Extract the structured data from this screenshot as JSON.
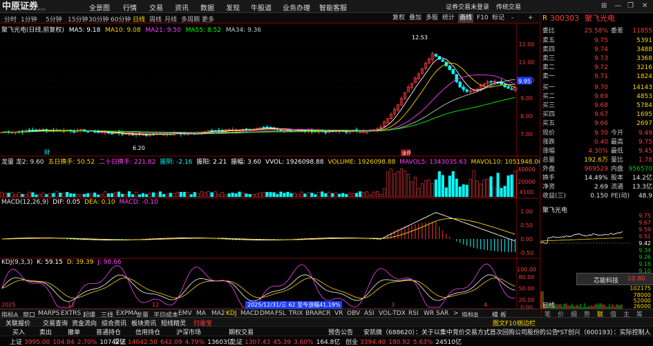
{
  "app": {
    "logo_text": "中原证券",
    "logo_sub": "CENTRAL CHINA SECURITIES",
    "menu": [
      "全景图",
      "行情",
      "交易",
      "资讯",
      "数据",
      "发现",
      "牛股道",
      "业务办理",
      "智能客服"
    ],
    "login": "证券交易未登录",
    "trade_link": "传统交易",
    "window_controls": [
      "⊞",
      "—",
      "❐",
      "✕"
    ]
  },
  "period_bar": {
    "periods": [
      "分时",
      "1分钟",
      "5分钟",
      "15分钟",
      "30分钟",
      "60分钟",
      "日线",
      "周线",
      "月线",
      "多周期",
      "更多"
    ],
    "active_index": 6,
    "tools": [
      "复权",
      "叠加",
      "多股",
      "统计",
      "画线",
      "F10",
      "标记",
      "-",
      "+"
    ],
    "tool_highlight_index": 4
  },
  "main_chart": {
    "title_name": "聚飞光电(日线,前复权)",
    "ma": [
      {
        "label": "MA5: 9.18",
        "color": "#ffffff"
      },
      {
        "label": "MA10: 9.08",
        "color": "#ffd700"
      },
      {
        "label": "MA21: 9.50",
        "color": "#ff40ff"
      },
      {
        "label": "MA55: 8.52",
        "color": "#00ff00"
      },
      {
        "label": "MA34: 9.36",
        "color": "#c8c8c8"
      }
    ],
    "y_ticks": [
      "12.00",
      "11.00",
      "10.00",
      "9.00",
      "8.00",
      "7.00"
    ],
    "y_tick_values": [
      12,
      11,
      10,
      9,
      8,
      7
    ],
    "high_label": "12.53",
    "low_label": "6.20",
    "current_price_label": "9.95",
    "marker_left": "财",
    "marker_right": "涨停",
    "date_label": "2025/12/31/三 62 至今涨幅41.19%"
  },
  "volume_panel": {
    "title": "龙量 龙2: 9.60",
    "items": [
      {
        "label": "五日换手: 50.52",
        "color": "#ffd700"
      },
      {
        "label": "二十日换手: 221.82",
        "color": "#ff40ff"
      },
      {
        "label": "振阴: -2.16",
        "color": "#00ffff"
      },
      {
        "label": "振阳: 2.21",
        "color": "#ffffff"
      },
      {
        "label": "振幅: 3.60",
        "color": "#ffffff"
      },
      {
        "label": "VVOL: 1926098.88",
        "color": "#ffffff"
      },
      {
        "label": "VOLUME: 1926098.88",
        "color": "#ffd700"
      },
      {
        "label": "MAVOL5: 1343035.63",
        "color": "#ff40ff"
      },
      {
        "label": "MAVOL10: 1051948.00",
        "color": "#ffd700"
      }
    ],
    "y_ticks": [
      "40000",
      "20000",
      "X100"
    ]
  },
  "macd_panel": {
    "title": "MACD(12,26,9)",
    "items": [
      {
        "label": "DIF: 0.05",
        "color": "#ffffff"
      },
      {
        "label": "DEA: 0.10",
        "color": "#ffd700"
      },
      {
        "label": "MACD: -0.10",
        "color": "#ff40ff"
      }
    ],
    "y_ticks": [
      "1.00",
      "0.50",
      "0.00",
      "-0.50"
    ]
  },
  "kdj_panel": {
    "title": "KDJ(9,3,3)",
    "items": [
      {
        "label": "K: 59.15",
        "color": "#ffffff"
      },
      {
        "label": "D: 39.39",
        "color": "#ffd700"
      },
      {
        "label": "J: 98.66",
        "color": "#ff40ff"
      }
    ],
    "y_ticks": [
      "100.00",
      "80.00",
      "50.00",
      "20.00",
      "0.00"
    ],
    "x_labels": [
      "2025",
      "11",
      "12",
      "1",
      "3",
      "4"
    ]
  },
  "indicator_bar": {
    "tabs": [
      "指标A",
      "窗口",
      "MARPS",
      "EXTRS",
      "起爆",
      "三线",
      "EXPMA",
      "龙量",
      "平均成本",
      "EMV",
      "MA",
      "MA2",
      "KDJ",
      "MACD",
      "DMA",
      "FSL",
      "TRIX",
      "BRAR",
      "CR",
      "VR",
      "OBV",
      "ASI",
      "VOL-TDX",
      "RSI",
      "WR",
      "SAR",
      ">",
      "指标B",
      "模",
      "板"
    ],
    "active": "KDJ"
  },
  "side_panel": {
    "code": "300303",
    "name": "聚飞光电",
    "weibi": {
      "label": "委比",
      "value": "25.58%",
      "label2": "委差",
      "value2": "11855"
    },
    "asks": [
      {
        "label": "卖五",
        "price": "9.75",
        "vol": "5391"
      },
      {
        "label": "卖四",
        "price": "9.74",
        "vol": "3488"
      },
      {
        "label": "卖三",
        "price": "9.73",
        "vol": "3368"
      },
      {
        "label": "卖二",
        "price": "9.72",
        "vol": "3216"
      },
      {
        "label": "卖一",
        "price": "9.71",
        "vol": "1824"
      }
    ],
    "bids": [
      {
        "label": "买一",
        "price": "9.70",
        "vol": "14143"
      },
      {
        "label": "买二",
        "price": "9.69",
        "vol": "4853"
      },
      {
        "label": "买三",
        "price": "9.68",
        "vol": "5784"
      },
      {
        "label": "买四",
        "price": "9.67",
        "vol": "1695"
      },
      {
        "label": "买五",
        "price": "9.66",
        "vol": "2697"
      }
    ],
    "stats": [
      {
        "l1": "现价",
        "v1": "9.70",
        "c1": "red",
        "l2": "今开",
        "v2": "9.49",
        "c2": "red"
      },
      {
        "l1": "涨跌",
        "v1": "0.40",
        "c1": "red",
        "l2": "最高",
        "v2": "9.75",
        "c2": "red"
      },
      {
        "l1": "涨幅",
        "v1": "4.30%",
        "c1": "red",
        "l2": "最低",
        "v2": "9.45",
        "c2": "red"
      },
      {
        "l1": "总量",
        "v1": "192.6万",
        "c1": "yellow",
        "l2": "量比",
        "v2": "1.78",
        "c2": "red"
      },
      {
        "l1": "外盘",
        "v1": "969529",
        "c1": "red",
        "l2": "内盘",
        "v2": "956570",
        "c2": "green"
      },
      {
        "l1": "换手",
        "v1": "14.49%",
        "c1": "white",
        "l2": "股本",
        "v2": "14.2亿",
        "c2": "white"
      },
      {
        "l1": "净资",
        "v1": "2.69",
        "c1": "white",
        "l2": "流通",
        "v2": "13.3亿",
        "c2": "white"
      },
      {
        "l1": "收益(三)",
        "v1": "0.150",
        "c1": "white",
        "l2": "PE(动)",
        "v2": "48.9",
        "c2": "white"
      }
    ],
    "mini_title": "聚飞光电",
    "mini_y": [
      "9.75",
      "9.67",
      "9.59",
      "9.51",
      "9.42",
      "9.34",
      "9.26",
      "9.18",
      "9.10"
    ],
    "mini_vol": "102175",
    "mini_vol2": "78000",
    "mini_vol3": "52000",
    "mini_vol4": "26000",
    "popup": {
      "name": "芯能科技",
      "price": "10.80"
    },
    "tab": "日线",
    "bottom_tabs": [
      "笔",
      "价",
      "细",
      "势",
      "联",
      "值",
      "主",
      "筹"
    ],
    "bottom_tab_active": 4
  },
  "bottom_bar1": {
    "items": [
      "关联报价",
      "交易查询",
      "资金流向",
      "综合资讯",
      "板块资讯",
      "短线精灵",
      "扫雷宝"
    ],
    "right": [
      "图文F10",
      "侧边栏"
    ]
  },
  "bottom_bar2": {
    "items": [
      "买入",
      "卖出",
      "撤单",
      "普通持仓",
      "信用持仓",
      "沪深市场",
      "期权交易"
    ],
    "news1": "预告公告",
    "news2": "安凯微（688620）：关于以集中竞价交易方式首次回购公司股份的公告",
    "news3": "*ST创兴（600193）：实际控制人ラ"
  },
  "bottom_bar3": [
    {
      "label": "上证",
      "v": "3995.00",
      "c": "104.84",
      "p": "2.70%",
      "amt": "10742亿"
    },
    {
      "label": "深证",
      "v": "14042.50",
      "c": "642.09",
      "p": "4.79%",
      "amt": "13603亿"
    },
    {
      "label": "北证",
      "v": "1307.43",
      "c": "45.39",
      "p": "3.60%",
      "amt": "164.8亿"
    },
    {
      "label": "创业",
      "v": "3394.40",
      "c": "180.92",
      "p": "5.63%",
      "amt": "24510亿"
    }
  ],
  "colors": {
    "up": "#ff3c3c",
    "down": "#00ffff",
    "accent": "#ffd700",
    "border": "#8b0000"
  }
}
